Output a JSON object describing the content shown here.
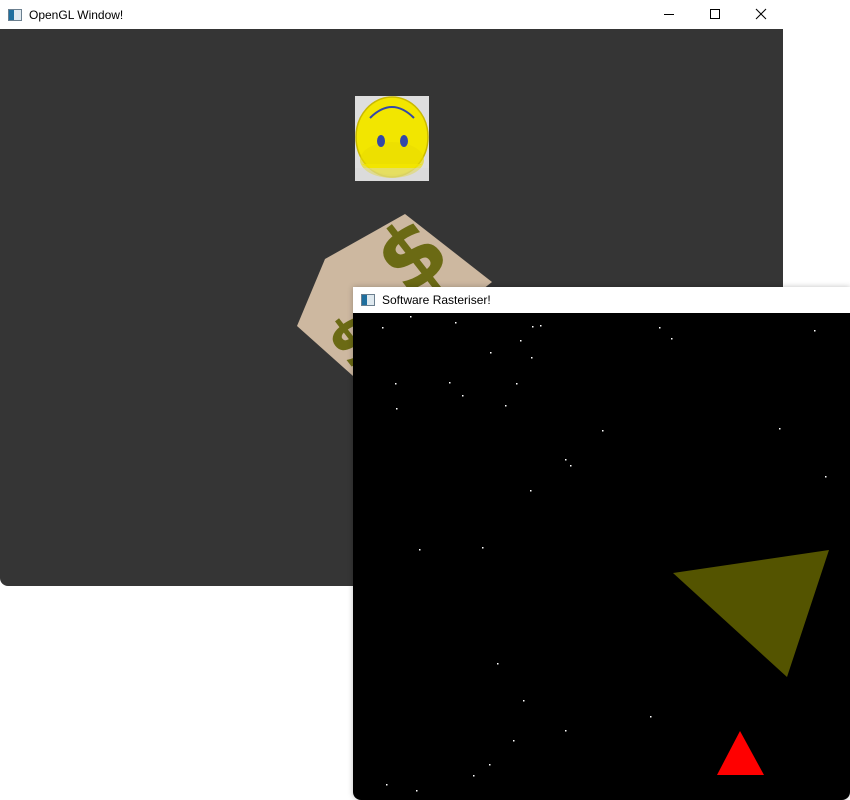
{
  "windows": {
    "opengl": {
      "title": "OpenGL Window!",
      "icon": "app-window-icon",
      "controls": [
        "minimize-icon",
        "maximize-icon",
        "close-icon"
      ],
      "background": "#353535"
    },
    "software": {
      "title": "Software Rasteriser!",
      "icon": "app-window-icon",
      "background": "#000000"
    }
  },
  "scene": {
    "smiley_color": "#f2e600",
    "dollar_tile_color": "#cdb8a0",
    "dollar_sign_color": "#6b6a14",
    "olive_triangle_color": "#545400",
    "red_triangle_color": "#ff0000",
    "star_color": "#ffffff"
  }
}
